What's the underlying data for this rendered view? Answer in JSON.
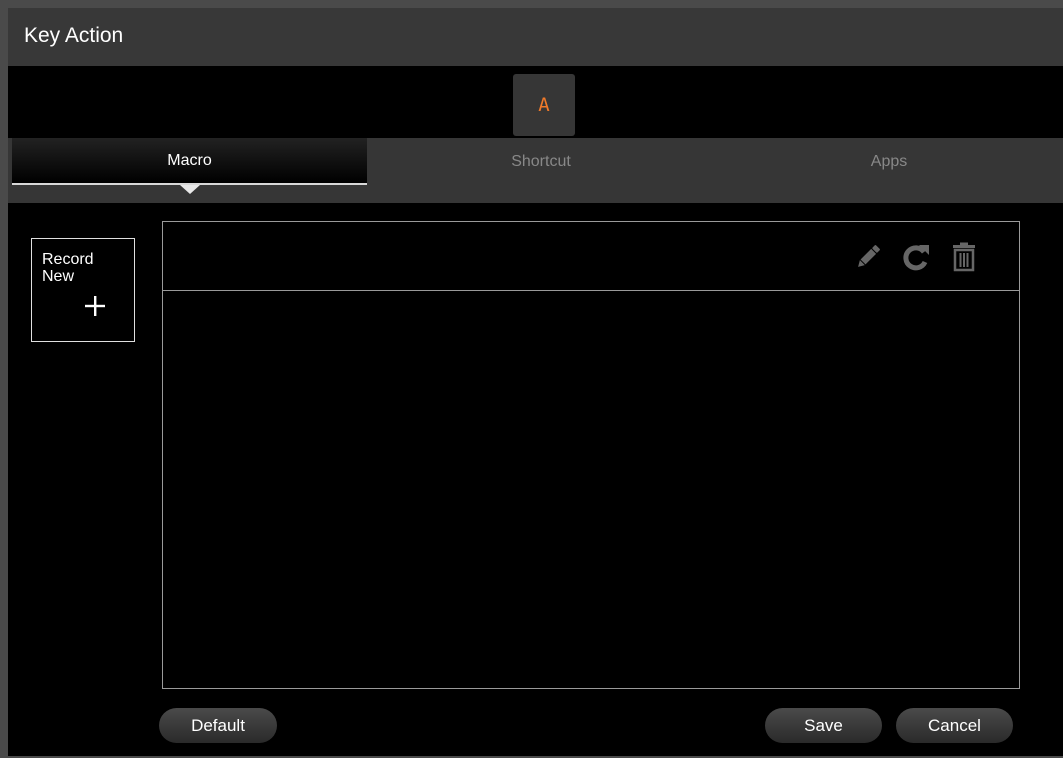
{
  "window": {
    "title": "Key Action"
  },
  "key": {
    "label": "A",
    "color": "#f07a2a"
  },
  "tabs": [
    {
      "label": "Macro",
      "active": true
    },
    {
      "label": "Shortcut",
      "active": false
    },
    {
      "label": "Apps",
      "active": false
    }
  ],
  "record_new": {
    "label": "Record New",
    "icon": "plus-icon"
  },
  "macro_toolbar": {
    "icons": [
      "edit-pencil-icon",
      "redo-icon",
      "trash-icon"
    ]
  },
  "buttons": {
    "default_label": "Default",
    "save_label": "Save",
    "cancel_label": "Cancel"
  }
}
